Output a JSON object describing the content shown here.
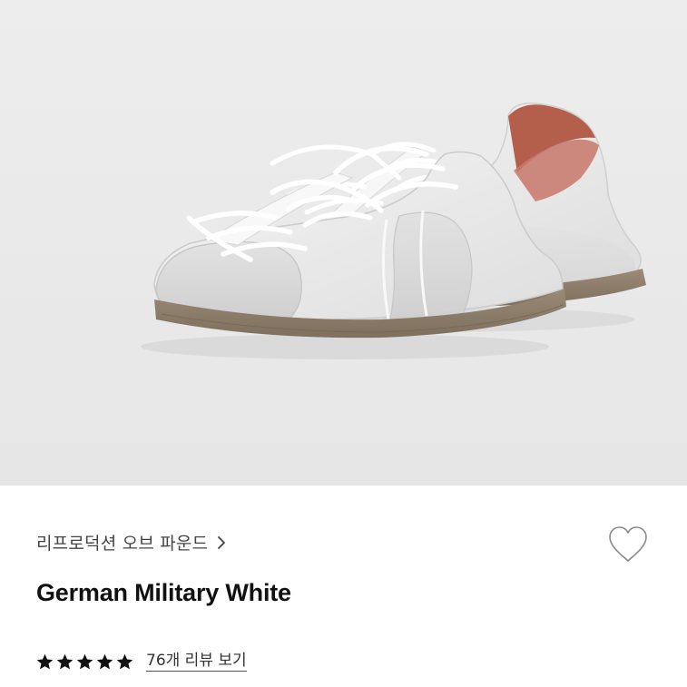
{
  "product": {
    "image_alt": "German Military White sneakers",
    "brand": "리프로덕션 오브 파운드",
    "title": "German Military White",
    "rating": {
      "stars": 5,
      "max": 5,
      "review_link_label": "76개 리뷰 보기"
    }
  },
  "icons": {
    "brand_chevron": "chevron-right-icon",
    "wishlist": "heart-outline-icon",
    "star": "star-filled-icon"
  },
  "colors": {
    "image_background": "#ebebeb",
    "star": "#111111",
    "brand_text": "#444444",
    "title_text": "#111111"
  }
}
